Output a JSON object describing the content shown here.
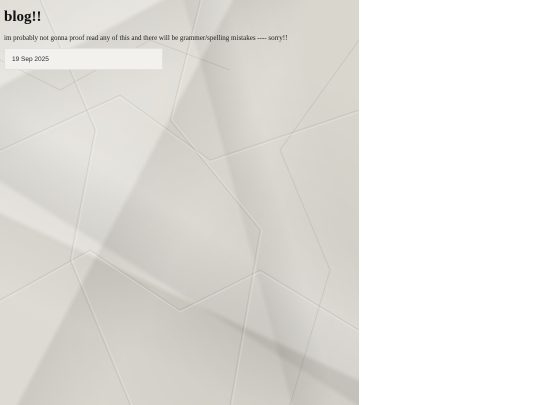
{
  "header": {
    "title": "blog!!",
    "note": "im probably not gonna proof read any of this and there will be grammer/spelling mistakes ---- sorry!!"
  },
  "posts": [
    {
      "date": "19 Sep 2025"
    }
  ],
  "colors": {
    "paper": "#d9d6ce",
    "card": "#f2f1ee",
    "text": "#111111"
  }
}
